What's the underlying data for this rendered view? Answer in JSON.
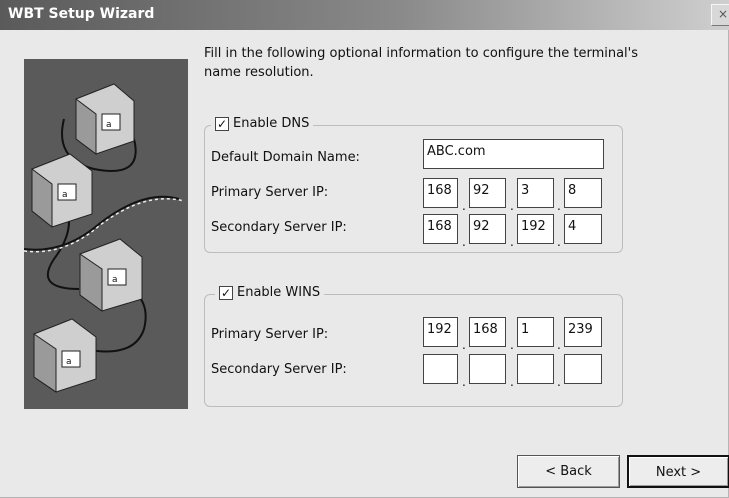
{
  "window": {
    "title": "WBT Setup Wizard",
    "close_label": "×"
  },
  "instructions": "Fill in the following optional information to configure the terminal's name resolution.",
  "dns": {
    "enable_label": "Enable DNS",
    "enabled": true,
    "domain_label": "Default Domain Name:",
    "domain_value": "ABC.com",
    "primary_label": "Primary Server IP:",
    "primary_ip": [
      "168",
      "92",
      "3",
      "8"
    ],
    "secondary_label": "Secondary Server IP:",
    "secondary_ip": [
      "168",
      "92",
      "192",
      "4"
    ]
  },
  "wins": {
    "enable_label": "Enable WINS",
    "enabled": true,
    "primary_label": "Primary Server IP:",
    "primary_ip": [
      "192",
      "168",
      "1",
      "239"
    ],
    "secondary_label": "Secondary Server IP:",
    "secondary_ip": [
      "",
      "",
      "",
      ""
    ]
  },
  "buttons": {
    "back_label": "< Back",
    "next_label": "Next >"
  },
  "checkmark": "✓",
  "ip_separator": ".",
  "icons": [
    "computer-terminal-icon",
    "network-cable-icon",
    "close-icon"
  ]
}
